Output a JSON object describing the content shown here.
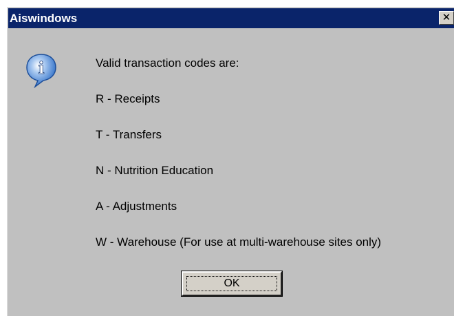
{
  "window": {
    "title": "Aiswindows",
    "close_label": "✕"
  },
  "icon": {
    "name": "information-icon",
    "glyph": "i",
    "fill_color": "#3f7fcf"
  },
  "message": {
    "heading": "Valid transaction codes are:",
    "codes": [
      "R - Receipts",
      "T - Transfers",
      "N - Nutrition Education",
      "A - Adjustments",
      "W - Warehouse (For use at multi-warehouse sites only)"
    ]
  },
  "buttons": {
    "ok_label": "OK"
  },
  "colors": {
    "titlebar": "#0a246a",
    "dialog_background": "#c0c0c0"
  }
}
